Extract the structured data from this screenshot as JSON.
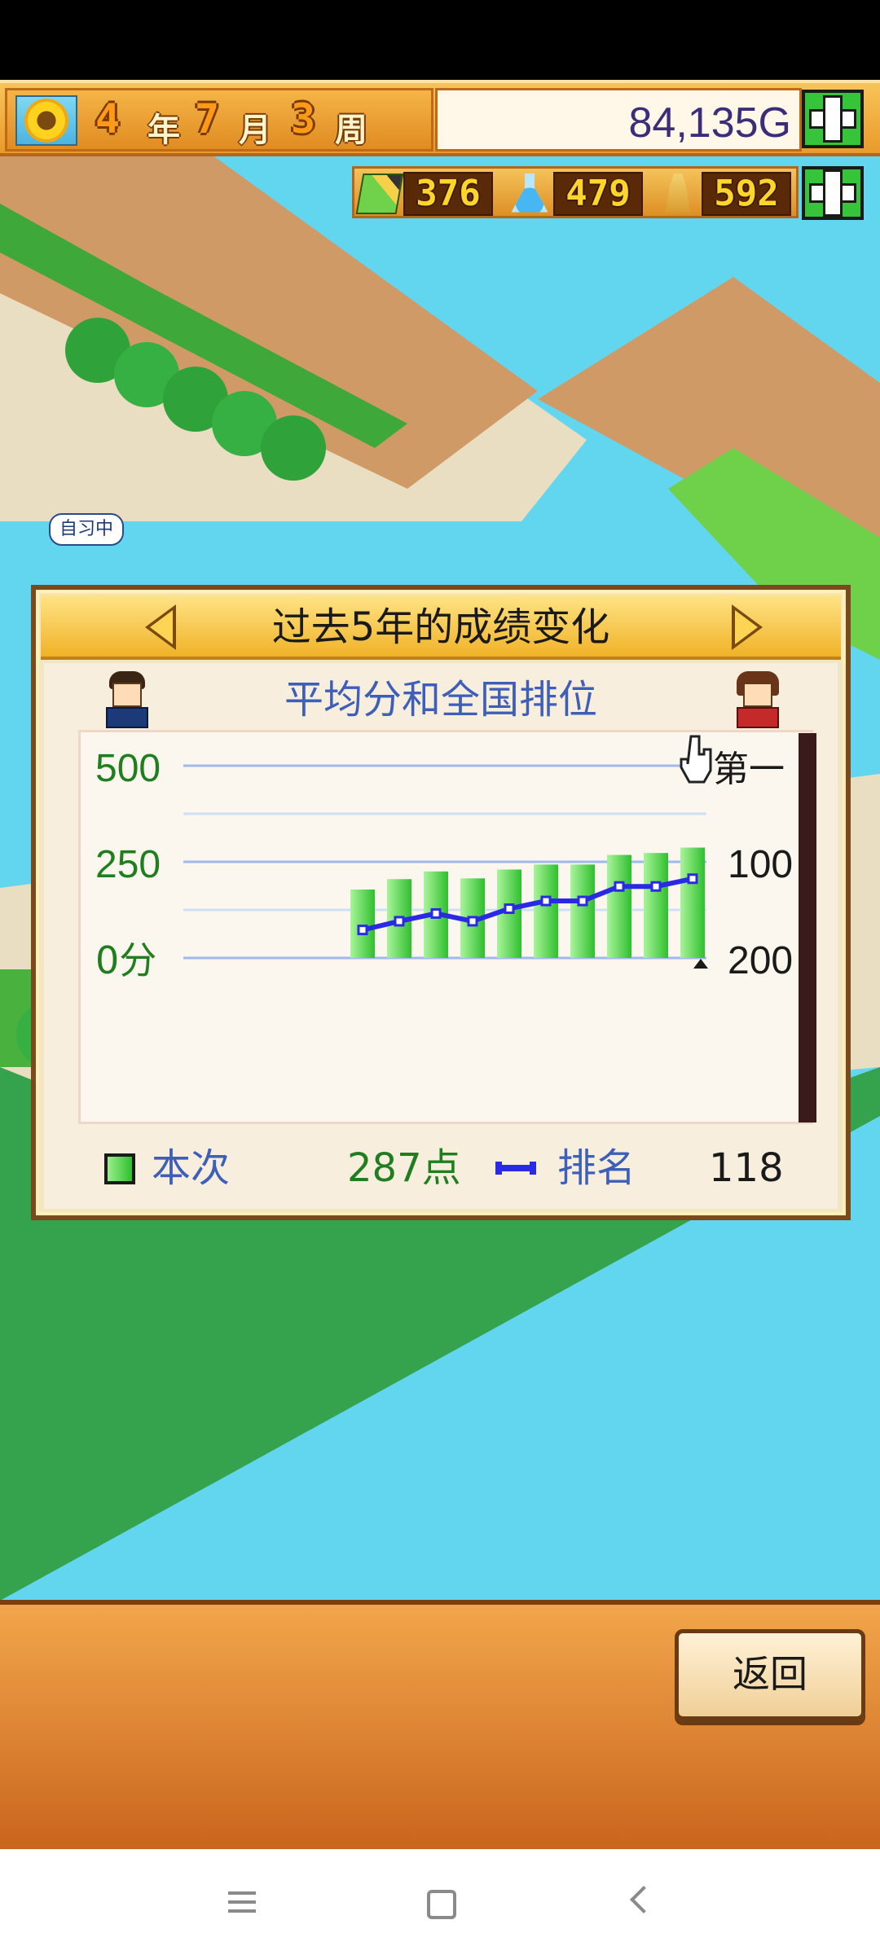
{
  "header": {
    "date": {
      "year": "4",
      "year_unit": "年",
      "month": "7",
      "month_unit": "月",
      "week": "3",
      "week_unit": "周"
    },
    "money": "84,135G",
    "resources": {
      "research_points": "376",
      "medicine": "479",
      "tower": "592"
    }
  },
  "world": {
    "speech_bubble": "自习中"
  },
  "dialog": {
    "title": "过去5年的成绩变化",
    "subtitle": "平均分和全国排位",
    "chart_labels": {
      "y_left_500": "500",
      "y_left_250": "250",
      "y_left_0": "0分",
      "y_right_top": "第一",
      "y_right_100": "100",
      "y_right_200": "200"
    },
    "legend": {
      "score_label": "本次",
      "score_value": "287点",
      "rank_label": "排名",
      "rank_value": "118"
    }
  },
  "chart_data": {
    "type": "bar",
    "ylim_left": [
      0,
      500
    ],
    "ylim_right_rank": [
      1,
      200
    ],
    "series": [
      {
        "type": "bar",
        "values": [
          178,
          205,
          225,
          207,
          230,
          243,
          243,
          268,
          273,
          287
        ],
        "color": "#3fcf3f"
      },
      {
        "type": "line",
        "values": [
          171,
          162,
          154,
          162,
          149,
          141,
          141,
          126,
          126,
          118
        ],
        "color": "#2a2ae6"
      }
    ],
    "grid": true
  },
  "bottom": {
    "back_label": "返回"
  },
  "colors": {
    "accent": "#f0b227",
    "score_text": "#1f7f1f",
    "label_text": "#3d5fb9",
    "rank_line": "#2a2ae6"
  }
}
